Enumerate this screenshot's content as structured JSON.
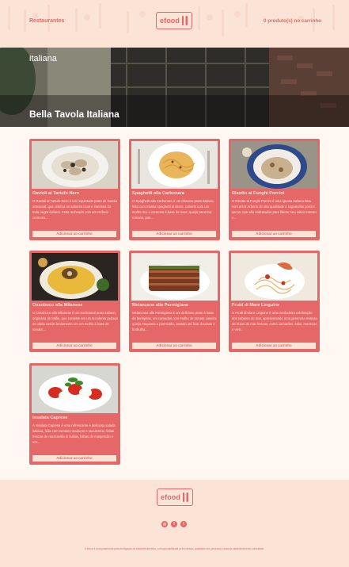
{
  "header": {
    "nav_restaurants": "Restaurantes",
    "logo_text": "efood",
    "cart_text": "0 produto(s) no carrinho"
  },
  "hero": {
    "category": "italiana",
    "title": "Bella Tavola Italiana"
  },
  "menu": [
    {
      "name": "Ravioli al Tartufo Nero",
      "description": "O Ravioli al Tartufo Nero é um requintado prato de massa artesanal, que celebra os sabores ricos e intensos da trufa negra italiana. Feito recheado com um recheio cremoso...",
      "button": "Adicionar ao carrinho",
      "photo": "ravioli-plate"
    },
    {
      "name": "Spaghetti alla Carbonara",
      "description": "O Spaghetti alla Carbonara é um clássico prato italiano, feito com massa spaghetti al dente, coberto com um molho rico e cremoso à base de ovos, queijo pecorino romano, pan...",
      "button": "Adicionar ao carrinho",
      "photo": "carbonara-plate"
    },
    {
      "name": "Risotto al Funghi Porcini",
      "description": "O Risotto al Funghi Porcini é uma iguaria italiana feita com arroz Arborio de alta qualidade e cogumelos porcini secos, que são reidratados para liberar seu sabor intenso e...",
      "button": "Adicionar ao carrinho",
      "photo": "risotto-plate"
    },
    {
      "name": "Ossobuco alla Milanese",
      "description": "O Ossobuco alla Milanese é um tradicional prato italiano, originário de Milão, que consiste em um suculento pedaço de vitela cozido lentamente em um molho à base de tomate,...",
      "button": "Adicionar ao carrinho",
      "photo": "ossobuco-plate"
    },
    {
      "name": "Melanzane alla Parmigiana",
      "description": "Melanzane alla Parmigiana é um delicioso prato à base de berinjelas, em camadas com molho de tomate caseiro, queijo muçarela e parmesão, assado até ficar dourado e borbulha...",
      "button": "Adicionar ao carrinho",
      "photo": "parmigiana-plate"
    },
    {
      "name": "Frutti di Mare Linguine",
      "description": "O Frutti di Mare Linguine é uma verdadeira celebração dos sabores do mar, apresentando uma generosa mistura de frutos do mar frescos, como camarões, lulas, mariscos e vieir...",
      "button": "Adicionar ao carrinho",
      "photo": "linguine-plate"
    },
    {
      "name": "Insalata Caprese",
      "description": "A Insalata Caprese é uma refrescante e deliciosa salada italiana, feita com tomates maduros e suculentos, fatias frescas de mozzarella di bufala, folhas de manjericão e um...",
      "button": "Adicionar ao carrinho",
      "photo": "caprese-plate"
    }
  ],
  "footer": {
    "logo_text": "efood",
    "socials": [
      "instagram-icon",
      "facebook-icon",
      "twitter-icon"
    ],
    "disclaimer": "A efood é uma plataforma para divulgação de estabelecimentos, a responsabilidade pela entrega, qualidade dos produtos é toda do estabelecimento contratado."
  },
  "colors": {
    "accent": "#e66767",
    "cream": "#fbe3d6",
    "background": "#fff8f2"
  }
}
